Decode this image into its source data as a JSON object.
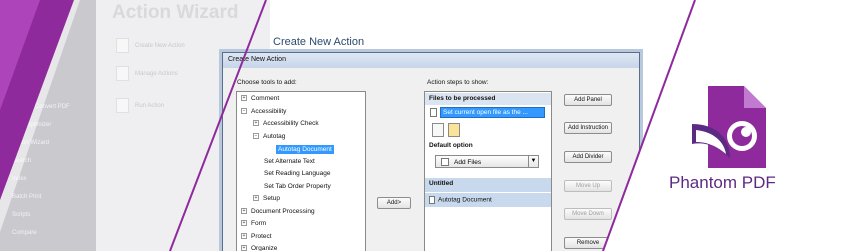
{
  "background_panel": {
    "title": "Action Wizard",
    "left_items": [
      "Fill & Sign",
      "Create / Convert PDF",
      "PDF Optimizer",
      "Action Wizard",
      "Search",
      "Index",
      "Batch Print",
      "Scripts",
      "Compare"
    ],
    "items": [
      "Create New Action",
      "Manage Actions",
      "Run Action"
    ]
  },
  "page_heading": "Create New Action",
  "dialog": {
    "title": "Create New Action",
    "tools_label": "Choose tools to add:",
    "steps_label": "Action steps to show:",
    "tree": [
      {
        "label": "Comment",
        "level": 0,
        "expander": "+"
      },
      {
        "label": "Accessibility",
        "level": 0,
        "expander": "-"
      },
      {
        "label": "Accessibility Check",
        "level": 1,
        "expander": "+"
      },
      {
        "label": "Autotag",
        "level": 1,
        "expander": "-"
      },
      {
        "label": "Autotag Document",
        "level": 2,
        "selected": true
      },
      {
        "label": "Set Alternate Text",
        "level": 1
      },
      {
        "label": "Set Reading Language",
        "level": 1
      },
      {
        "label": "Set Tab Order Property",
        "level": 1
      },
      {
        "label": "Setup",
        "level": 1,
        "expander": "+"
      },
      {
        "label": "Document Processing",
        "level": 0,
        "expander": "+"
      },
      {
        "label": "Form",
        "level": 0,
        "expander": "+"
      },
      {
        "label": "Protect",
        "level": 0,
        "expander": "+"
      },
      {
        "label": "Organize",
        "level": 0,
        "expander": "+"
      }
    ],
    "add_button": "Add>",
    "files_section": "Files to be processed",
    "files_value": "Set current open file as the ...",
    "default_option_label": "Default option",
    "add_files_button": "Add Files",
    "untitled_section": "Untitled",
    "step_item": "Autotag Document",
    "side_buttons": {
      "add_panel": "Add Panel",
      "add_instruction": "Add Instruction",
      "add_divider": "Add Divider",
      "move_up": "Move Up",
      "move_down": "Move Down",
      "remove": "Remove"
    }
  },
  "logo": {
    "product": "Phantom PDF",
    "color": "#8e2a9c"
  },
  "colors": {
    "accent": "#8e2a9c",
    "heading": "#2b4a72",
    "selection": "#3399ff"
  }
}
